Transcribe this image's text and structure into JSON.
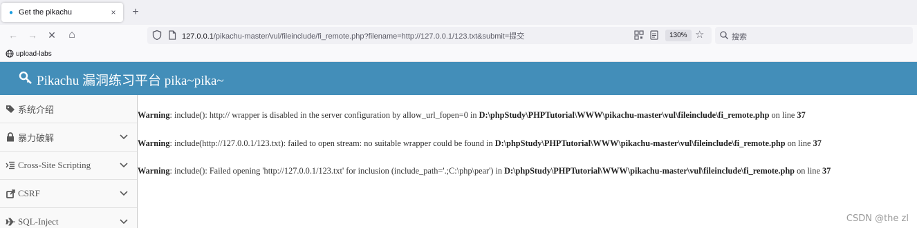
{
  "browser": {
    "tab": {
      "title": "Get the pikachu",
      "close_glyph": "×"
    },
    "new_tab_glyph": "+",
    "nav": {
      "back_glyph": "←",
      "forward_glyph": "→",
      "stop_glyph": "✕",
      "home_glyph": "⌂"
    },
    "address": {
      "host": "127.0.0.1",
      "path": "/pikachu-master/vul/fileinclude/fi_remote.php?filename=http://127.0.0.1/123.txt&submit=提交",
      "zoom": "130%",
      "star_glyph": "☆"
    },
    "search": {
      "placeholder": "搜索"
    },
    "bookmarks": [
      {
        "label": "upload-labs"
      }
    ]
  },
  "header": {
    "title": "Pikachu 漏洞练习平台 pika~pika~"
  },
  "sidebar": {
    "items": [
      {
        "label": "系统介绍",
        "icon": "tag-icon"
      },
      {
        "label": "暴力破解",
        "icon": "lock-icon"
      },
      {
        "label": "Cross-Site Scripting",
        "icon": "list-indent-icon"
      },
      {
        "label": "CSRF",
        "icon": "external-link-icon"
      },
      {
        "label": "SQL-Inject",
        "icon": "plane-icon"
      }
    ]
  },
  "warnings": [
    {
      "label": "Warning",
      "message": ": include(): http:// wrapper is disabled in the server configuration by allow_url_fopen=0 in ",
      "file": "D:\\phpStudy\\PHPTutorial\\WWW\\pikachu-master\\vul\\fileinclude\\fi_remote.php",
      "line_text": " on line ",
      "line": "37"
    },
    {
      "label": "Warning",
      "message": ": include(http://127.0.0.1/123.txt): failed to open stream: no suitable wrapper could be found in ",
      "file": "D:\\phpStudy\\PHPTutorial\\WWW\\pikachu-master\\vul\\fileinclude\\fi_remote.php",
      "line_text": " on line ",
      "line": "37"
    },
    {
      "label": "Warning",
      "message": ": include(): Failed opening 'http://127.0.0.1/123.txt' for inclusion (include_path='.;C:\\php\\pear') in ",
      "file": "D:\\phpStudy\\PHPTutorial\\WWW\\pikachu-master\\vul\\fileinclude\\fi_remote.php",
      "line_text": " on line ",
      "line": "37"
    }
  ],
  "watermark": "CSDN @the zl"
}
